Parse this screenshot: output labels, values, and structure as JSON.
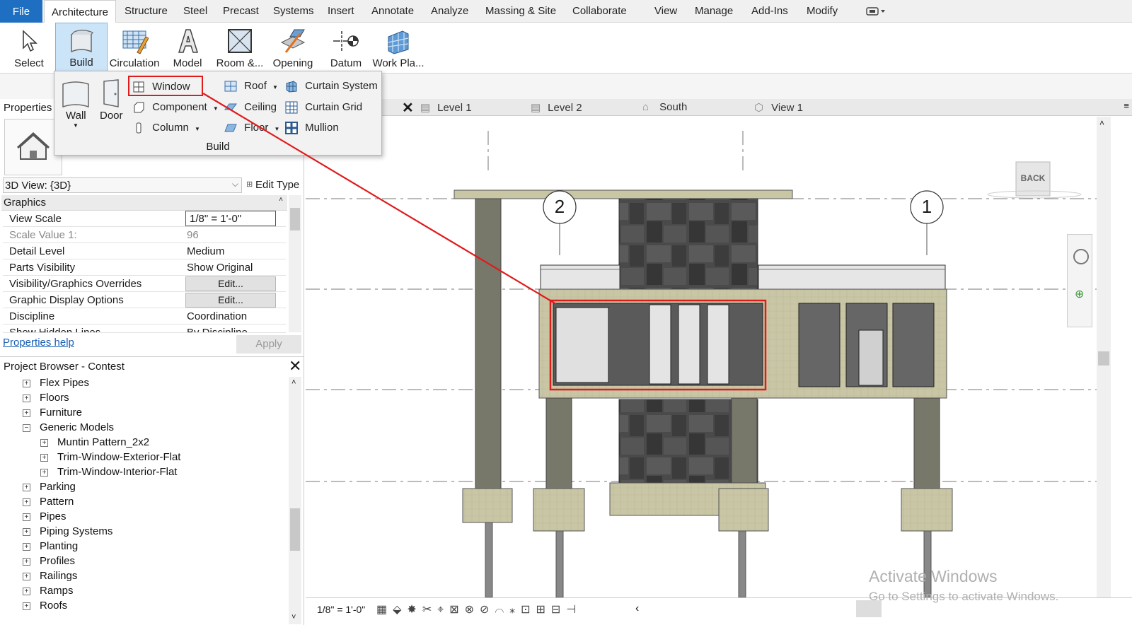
{
  "menu": {
    "file": "File",
    "tabs": [
      "Architecture",
      "Structure",
      "Steel",
      "Precast",
      "Systems",
      "Insert",
      "Annotate",
      "Analyze",
      "Massing & Site",
      "Collaborate",
      "View",
      "Manage",
      "Add-Ins",
      "Modify"
    ]
  },
  "ribbon": {
    "buttons": [
      {
        "label": "Select",
        "icon": "cursor-icon"
      },
      {
        "label": "Build",
        "icon": "wall-icon"
      },
      {
        "label": "Circulation",
        "icon": "stairs-icon"
      },
      {
        "label": "Model",
        "icon": "model-text-icon"
      },
      {
        "label": "Room &...",
        "icon": "room-icon"
      },
      {
        "label": "Opening",
        "icon": "opening-icon"
      },
      {
        "label": "Datum",
        "icon": "datum-icon"
      },
      {
        "label": "Work Pla...",
        "icon": "work-plane-icon"
      }
    ]
  },
  "build_panel": {
    "title": "Build",
    "wall": "Wall",
    "door": "Door",
    "window": "Window",
    "component": "Component",
    "column": "Column",
    "roof": "Roof",
    "ceiling": "Ceiling",
    "floor": "Floor",
    "curtain_system": "Curtain  System",
    "curtain_grid": "Curtain  Grid",
    "mullion": "Mullion"
  },
  "properties": {
    "title": "Properties",
    "type_selector": "3D View: {3D}",
    "edit_type": "Edit Type",
    "section": "Graphics",
    "rows": [
      {
        "key": "View Scale",
        "value": "1/8\" = 1'-0\""
      },
      {
        "key": "Scale Value    1:",
        "value": "96"
      },
      {
        "key": "Detail Level",
        "value": "Medium"
      },
      {
        "key": "Parts Visibility",
        "value": "Show Original"
      },
      {
        "key": "Visibility/Graphics Overrides",
        "value": "Edit..."
      },
      {
        "key": "Graphic Display Options",
        "value": "Edit..."
      },
      {
        "key": "Discipline",
        "value": "Coordination"
      },
      {
        "key": "Show Hidden Lines",
        "value": "By Discipline"
      }
    ],
    "help": "Properties help",
    "apply": "Apply"
  },
  "browser": {
    "title": "Project Browser - Contest",
    "items": [
      {
        "label": "Flex Pipes",
        "level": 1,
        "sign": "+"
      },
      {
        "label": "Floors",
        "level": 1,
        "sign": "+"
      },
      {
        "label": "Furniture",
        "level": 1,
        "sign": "+"
      },
      {
        "label": "Generic Models",
        "level": 1,
        "sign": "−"
      },
      {
        "label": "Muntin Pattern_2x2",
        "level": 2,
        "sign": "+"
      },
      {
        "label": "Trim-Window-Exterior-Flat",
        "level": 2,
        "sign": "+"
      },
      {
        "label": "Trim-Window-Interior-Flat",
        "level": 2,
        "sign": "+"
      },
      {
        "label": "Parking",
        "level": 1,
        "sign": "+"
      },
      {
        "label": "Pattern",
        "level": 1,
        "sign": "+"
      },
      {
        "label": "Pipes",
        "level": 1,
        "sign": "+"
      },
      {
        "label": "Piping Systems",
        "level": 1,
        "sign": "+"
      },
      {
        "label": "Planting",
        "level": 1,
        "sign": "+"
      },
      {
        "label": "Profiles",
        "level": 1,
        "sign": "+"
      },
      {
        "label": "Railings",
        "level": 1,
        "sign": "+"
      },
      {
        "label": "Ramps",
        "level": 1,
        "sign": "+"
      },
      {
        "label": "Roofs",
        "level": 1,
        "sign": "+"
      }
    ]
  },
  "view_tabs": [
    "Level 1",
    "Level 2",
    "South",
    "View 1"
  ],
  "canvas": {
    "grid_2": "2",
    "grid_1": "1",
    "viewcube": "BACK"
  },
  "status": {
    "scale": "1/8\" = 1'-0\""
  },
  "watermark": {
    "line1": "Activate Windows",
    "line2": "Go to Settings to activate Windows."
  },
  "colors": {
    "file_blue": "#1e6fc2",
    "highlight_red": "#e01b1b",
    "build_selected": "#cce4f7"
  }
}
